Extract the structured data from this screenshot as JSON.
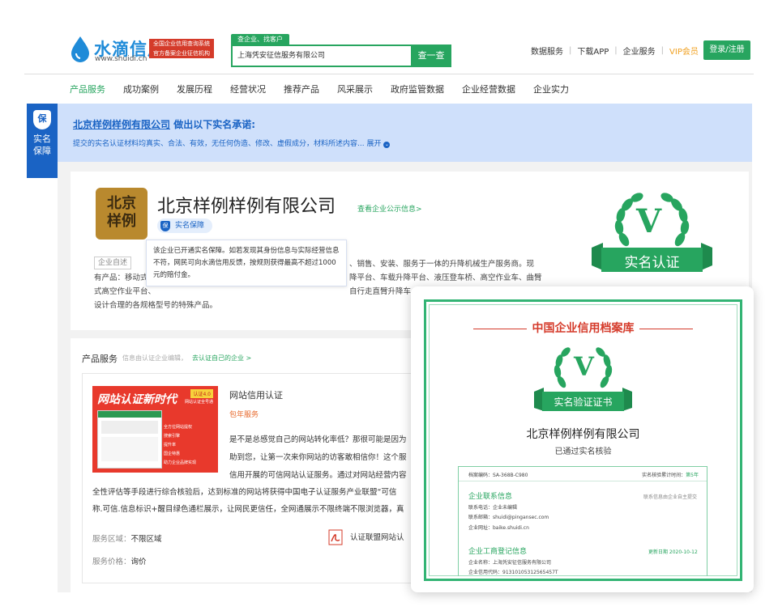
{
  "header": {
    "logo_cn": "水滴信用",
    "logo_en": "www.shuidi.cn",
    "logo_tag_line1": "全国企业信用查询系统",
    "logo_tag_line2": "官方备案企业征信机构",
    "search_tab": "查企业、找客户",
    "search_value": "上海凭安征信服务有限公司",
    "search_button": "查一查",
    "links": [
      "数据服务",
      "下载APP",
      "企业服务"
    ],
    "vip": "VIP会员",
    "login": "登录/注册"
  },
  "nav": [
    "产品服务",
    "成功案例",
    "发展历程",
    "经营状况",
    "推荐产品",
    "风采展示",
    "政府监管数据",
    "企业经营数据",
    "企业实力"
  ],
  "side_badge": {
    "icon_char": "保",
    "line1": "实名",
    "line2": "保障"
  },
  "banner": {
    "company": "北京样例样例有限公司",
    "title_rest": "做出以下实名承诺:",
    "subtitle": "提交的实名认证材料均真实、合法、有效，无任何伪造、修改、虚假成分，材料所述内容...",
    "expand": "展开"
  },
  "company": {
    "logo_line1": "北京",
    "logo_line2": "样例",
    "name": "北京样例样例有限公司",
    "public_info_link": "查看企业公示信息>",
    "badge_icon": "保",
    "badge": "实名保障",
    "tooltip": "该企业已开通实名保障。如若发现其身份信息与实际经营信息不符，网民可向水滴信用反馈，按规则获得最高不超过1000元的赔付金。",
    "self_desc_tag": "企业自述",
    "desc_line1_tail": "、销售、安装、服务于一体的升降机械生产服务商。现",
    "desc_line2_head": "有产品：移动式",
    "desc_line2_tail": "降平台、车载升降平台、液压登车桥、高空作业车、曲臂",
    "desc_line3_head": "式高空作业平台、",
    "desc_line3_tail": "自行走直臂升降车、自",
    "desc_line4": "设计合理的各规格型号的特殊产品。",
    "emblem_letter": "V",
    "emblem_text": "实名认证"
  },
  "products": {
    "title": "产品服务",
    "hint": "信息由认证企业编辑，",
    "link": "去认证自己的企业 >",
    "promo_title": "网站认证新时代",
    "promo_badge": "认证4.0",
    "promo_sub": "网站认证全号通",
    "promo_items": [
      "全方位网站提权",
      "搜索引擎",
      "提升率",
      "国企特惠",
      "助力企业品牌实现"
    ],
    "name": "网站信用认证",
    "tag": "包年服务",
    "desc_line1": "是不是总感觉自己的网站转化率低？那很可能是因为",
    "desc_line2": "助到您，让第一次来你网站的访客敢相信你！这个服",
    "desc_line3": "信用开展的可信网站认证服务。通过对网站经营内容",
    "desc_line4": "全性评估等手段进行综合核验后，达到标准的网站将获得中国电子认证服务产业联盟“可信",
    "desc_line5": "称.可信.信息标识+醒目绿色通栏展示，让网民更信任，全网通展示不限终端不限浏览器，真",
    "area_label": "服务区域：",
    "area_value": "不限区域",
    "price_label": "服务价格：",
    "price_value": "询价",
    "pdf_label": "认证联盟网站认"
  },
  "certificate": {
    "title": "中国企业信用档案库",
    "letter": "V",
    "ribbon": "实名验证证书",
    "company": "北京样例样例有限公司",
    "status": "已通过实名核验",
    "archive_no": "档案编码：SA-368B-C980",
    "verified_years_label": "实名核验累计时间：",
    "verified_years_value": "第5年",
    "contact_section": "企业联系信息",
    "contact_note": "联系信息由企业自主提交",
    "phone": "联系电话：企业未编辑",
    "email": "联系邮箱：shuidi@pingansec.com",
    "website": "企业网址：baike.shuidi.cn",
    "registry_section": "企业工商登记信息",
    "update_label": "更新日期 2020-10-12",
    "reg_name": "企业名称：上海凭安征信服务有限公司",
    "credit_code": "企业信用代码：913101053125654​57T"
  },
  "colors": {
    "brand_green": "#27a55f",
    "brand_blue": "#1a63c4",
    "banner_bg": "#cfe0fb",
    "alert_red": "#d53b2b"
  }
}
